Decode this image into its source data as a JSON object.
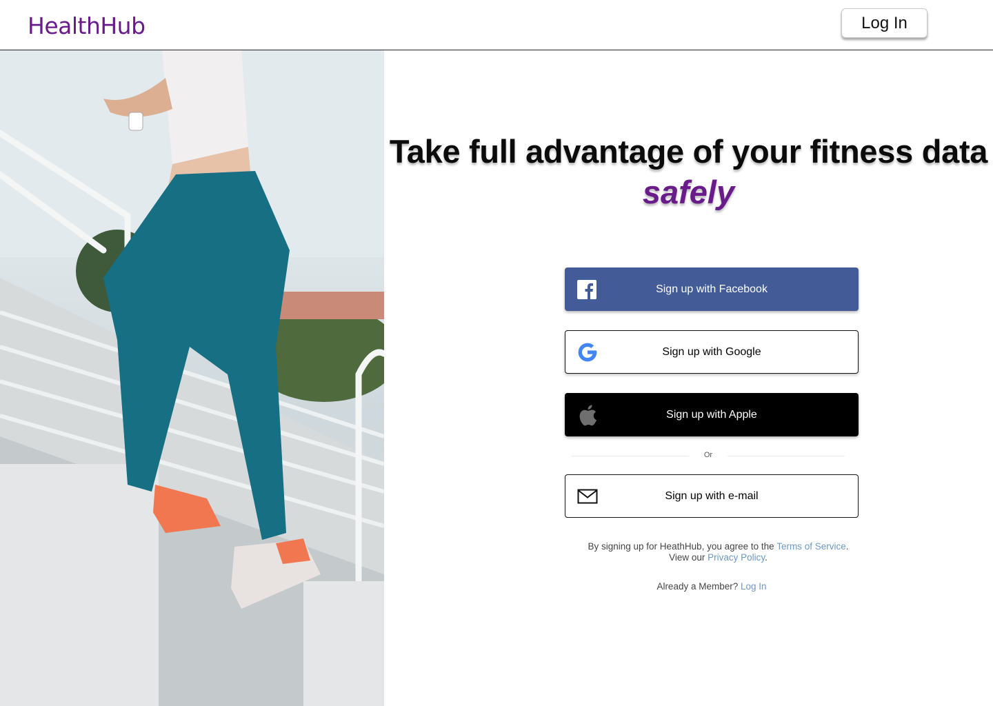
{
  "header": {
    "logo": "HealthHub",
    "login_label": "Log In"
  },
  "hero": {
    "image_desc": "runner-on-stadium-stairs"
  },
  "headline": {
    "line1": "Take full advantage of your fitness data",
    "line2": "safely"
  },
  "signup": {
    "facebook_label": "Sign up with Facebook",
    "google_label": "Sign up with Google",
    "apple_label": "Sign up with Apple",
    "divider_label": "Or",
    "email_label": "Sign up with e-mail"
  },
  "legal": {
    "prefix": "By signing up for HeathHub, you agree to the ",
    "terms_link": "Terms of Service",
    "mid": ".",
    "view_prefix": "View our ",
    "privacy_link": "Privacy Policy",
    "suffix": "."
  },
  "member": {
    "prompt": "Already a Member? ",
    "login_link": "Log In"
  },
  "colors": {
    "brand": "#6a1b8a",
    "facebook": "#435c98",
    "apple": "#000000",
    "link": "#6b98c5"
  }
}
